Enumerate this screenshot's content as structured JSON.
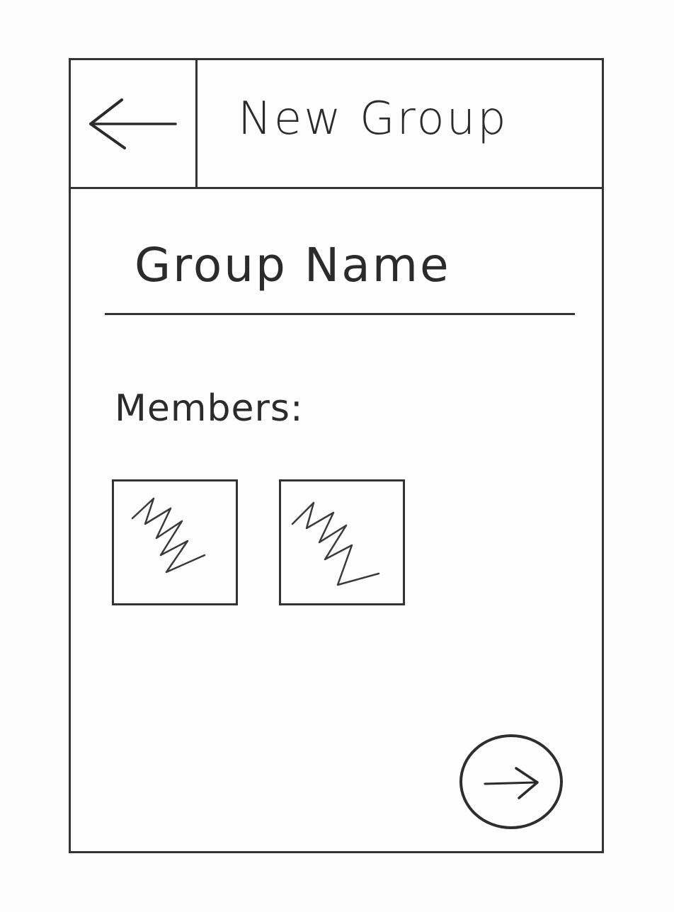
{
  "header": {
    "title": "New Group",
    "back_icon": "arrow-left-icon"
  },
  "form": {
    "group_name_placeholder": "Group Name"
  },
  "members": {
    "label": "Members:",
    "items": [
      {
        "icon": "scribble-placeholder-icon"
      },
      {
        "icon": "scribble-placeholder-icon"
      }
    ]
  },
  "actions": {
    "next_icon": "arrow-right-icon"
  }
}
